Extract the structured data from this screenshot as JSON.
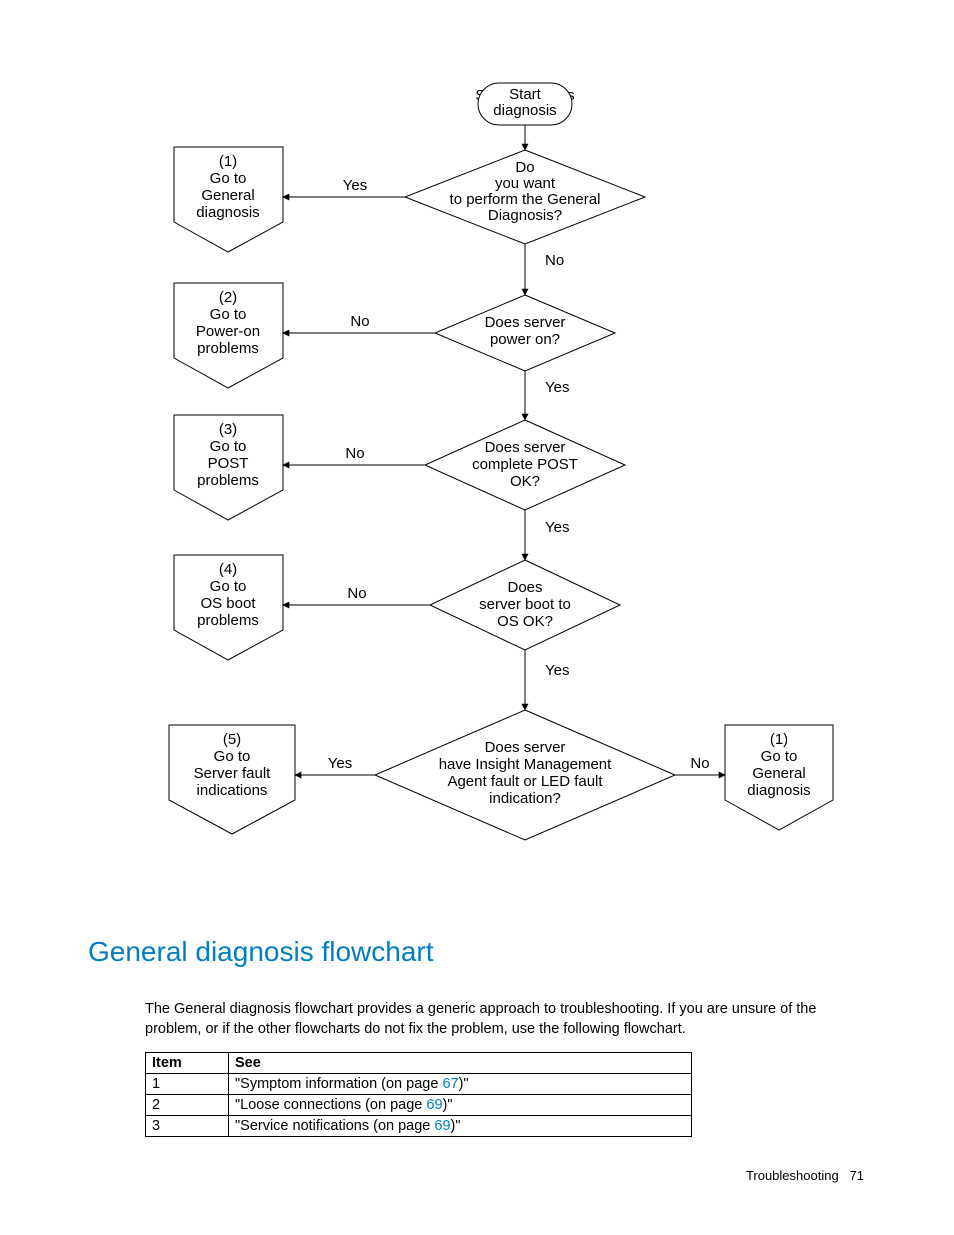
{
  "flow": {
    "start": "Start diagnosis",
    "q1": {
      "l1": "Do",
      "l2": "you want",
      "l3": "to perform the General",
      "l4": "Diagnosis?",
      "yes": "Yes",
      "no": "No"
    },
    "q2": {
      "l1": "Does server",
      "l2": "power on?",
      "yes": "Yes",
      "no": "No"
    },
    "q3": {
      "l1": "Does server",
      "l2": "complete POST",
      "l3": "OK?",
      "yes": "Yes",
      "no": "No"
    },
    "q4": {
      "l1": "Does",
      "l2": "server boot to",
      "l3": "OS OK?",
      "yes": "Yes",
      "no": "No"
    },
    "q5": {
      "l1": "Does server",
      "l2": "have Insight Management",
      "l3": "Agent fault or LED fault",
      "l4": "indication?",
      "yes": "Yes",
      "no": "No"
    },
    "o1": {
      "n": "(1)",
      "a": "Go to",
      "b": "General",
      "c": "diagnosis"
    },
    "o2": {
      "n": "(2)",
      "a": "Go to",
      "b": "Power-on",
      "c": "problems"
    },
    "o3": {
      "n": "(3)",
      "a": "Go to",
      "b": "POST",
      "c": "problems"
    },
    "o4": {
      "n": "(4)",
      "a": "Go to",
      "b": "OS boot",
      "c": "problems"
    },
    "o5": {
      "n": "(5)",
      "a": "Go to",
      "b": "Server fault",
      "c": "indications"
    },
    "o6": {
      "n": "(1)",
      "a": "Go to",
      "b": "General",
      "c": "diagnosis"
    }
  },
  "heading": "General diagnosis flowchart",
  "para": "The General diagnosis flowchart provides a generic approach to troubleshooting. If you are unsure of the problem, or if the other flowcharts do not fix the problem, use the following flowchart.",
  "table": {
    "head": {
      "item": "Item",
      "see": "See"
    },
    "rows": [
      {
        "item": "1",
        "pre": "\"Symptom information (on page ",
        "page": "67",
        "post": ")\""
      },
      {
        "item": "2",
        "pre": "\"Loose connections (on page ",
        "page": "69",
        "post": ")\""
      },
      {
        "item": "3",
        "pre": "\"Service notifications (on page ",
        "page": "69",
        "post": ")\""
      }
    ]
  },
  "footer": {
    "section": "Troubleshooting",
    "page": "71"
  }
}
